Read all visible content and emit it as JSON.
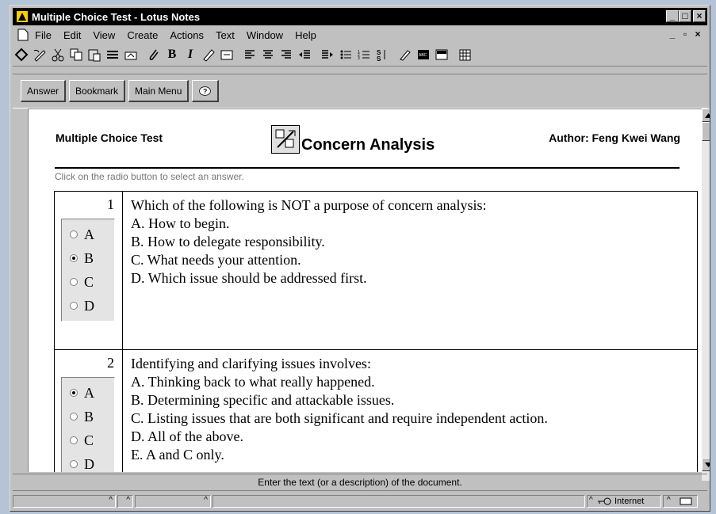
{
  "window": {
    "title": "Multiple Choice Test - Lotus Notes",
    "controls": {
      "minimize": "_",
      "maximize": "□",
      "close": "×"
    },
    "mdi_controls": {
      "minimize": "_",
      "restore": "▫",
      "close": "×"
    }
  },
  "menu": {
    "items": [
      {
        "label": "File"
      },
      {
        "label": "Edit"
      },
      {
        "label": "View"
      },
      {
        "label": "Create"
      },
      {
        "label": "Actions"
      },
      {
        "label": "Text"
      },
      {
        "label": "Window"
      },
      {
        "label": "Help"
      }
    ]
  },
  "toolbar": {
    "icons": [
      "navigator-icon",
      "edit-mode-icon",
      "cut-icon",
      "copy-icon",
      "paste-icon",
      "properties-icon",
      "link-icon",
      "attach-icon",
      "bold-icon",
      "italic-icon",
      "highlight-icon",
      "insert-icon",
      "align-left-icon",
      "align-center-icon",
      "align-right-icon",
      "indent-icon",
      "outdent-icon",
      "bullets-icon",
      "numbers-icon",
      "styles-icon",
      "tool-icon",
      "spellcheck-icon",
      "table-icon",
      "grid-icon"
    ],
    "bold_label": "B",
    "italic_label": "I"
  },
  "actionbar": {
    "answer": "Answer",
    "bookmark": "Bookmark",
    "main_menu": "Main Menu",
    "help": "?"
  },
  "document": {
    "header_left": "Multiple Choice Test",
    "title": "Concern Analysis",
    "header_right": "Author: Feng Kwei Wang",
    "instruction": "Click on the radio button to select an answer.",
    "questions": [
      {
        "number": "1",
        "options": [
          "A",
          "B",
          "C",
          "D"
        ],
        "selected": "B",
        "prompt": "Which of the following is NOT a purpose of concern analysis:",
        "choices": [
          "A. How to begin.",
          "B. How to delegate responsibility.",
          "C. What needs your attention.",
          "D. Which issue should be addressed first."
        ]
      },
      {
        "number": "2",
        "options": [
          "A",
          "B",
          "C",
          "D"
        ],
        "selected": "A",
        "prompt": "Identifying and clarifying issues involves:",
        "choices": [
          "A. Thinking back to what really happened.",
          "B. Determining specific and attackable issues.",
          "C. Listing issues that are both significant and require independent action.",
          "D. All of the above.",
          "E. A and C only."
        ]
      }
    ]
  },
  "status": {
    "message": "Enter the text (or a description) of the document.",
    "zone": "Internet"
  }
}
